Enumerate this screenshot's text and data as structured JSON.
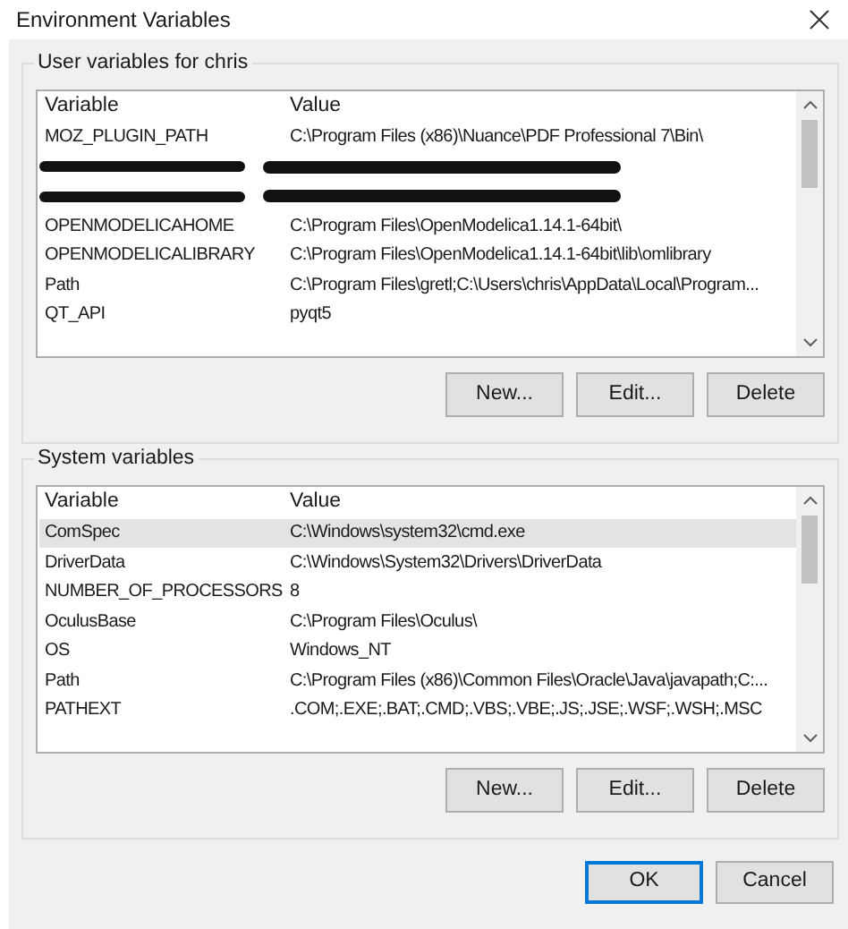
{
  "window": {
    "title": "Environment Variables"
  },
  "sections": [
    {
      "title": "User variables for chris",
      "columns": [
        "Variable",
        "Value"
      ],
      "rows": [
        {
          "kind": "text",
          "selected": false,
          "cells": [
            "MOZ_PLUGIN_PATH",
            "C:\\Program Files (x86)\\Nuance\\PDF Professional 7\\Bin\\"
          ]
        },
        {
          "kind": "redacted",
          "selected": false
        },
        {
          "kind": "redacted",
          "selected": false
        },
        {
          "kind": "text",
          "selected": false,
          "cells": [
            "OPENMODELICAHOME",
            "C:\\Program Files\\OpenModelica1.14.1-64bit\\"
          ]
        },
        {
          "kind": "text",
          "selected": false,
          "cells": [
            "OPENMODELICALIBRARY",
            "C:\\Program Files\\OpenModelica1.14.1-64bit\\lib\\omlibrary"
          ]
        },
        {
          "kind": "text",
          "selected": false,
          "cells": [
            "Path",
            "C:\\Program Files\\gretl;C:\\Users\\chris\\AppData\\Local\\Program..."
          ]
        },
        {
          "kind": "text",
          "selected": false,
          "cells": [
            "QT_API",
            "pyqt5"
          ]
        }
      ],
      "buttons": [
        "New...",
        "Edit...",
        "Delete"
      ]
    },
    {
      "title": "System variables",
      "columns": [
        "Variable",
        "Value"
      ],
      "rows": [
        {
          "kind": "text",
          "selected": true,
          "cells": [
            "ComSpec",
            "C:\\Windows\\system32\\cmd.exe"
          ]
        },
        {
          "kind": "text",
          "selected": false,
          "cells": [
            "DriverData",
            "C:\\Windows\\System32\\Drivers\\DriverData"
          ]
        },
        {
          "kind": "text",
          "selected": false,
          "cells": [
            "NUMBER_OF_PROCESSORS",
            "8"
          ]
        },
        {
          "kind": "text",
          "selected": false,
          "cells": [
            "OculusBase",
            "C:\\Program Files\\Oculus\\"
          ]
        },
        {
          "kind": "text",
          "selected": false,
          "cells": [
            "OS",
            "Windows_NT"
          ]
        },
        {
          "kind": "text",
          "selected": false,
          "cells": [
            "Path",
            "C:\\Program Files (x86)\\Common Files\\Oracle\\Java\\javapath;C:..."
          ]
        },
        {
          "kind": "text",
          "selected": false,
          "cells": [
            "PATHEXT",
            ".COM;.EXE;.BAT;.CMD;.VBS;.VBE;.JS;.JSE;.WSF;.WSH;.MSC"
          ]
        }
      ],
      "buttons": [
        "New...",
        "Edit...",
        "Delete"
      ]
    }
  ],
  "dialog_buttons": [
    {
      "label": "OK",
      "default": true
    },
    {
      "label": "Cancel",
      "default": false
    }
  ]
}
